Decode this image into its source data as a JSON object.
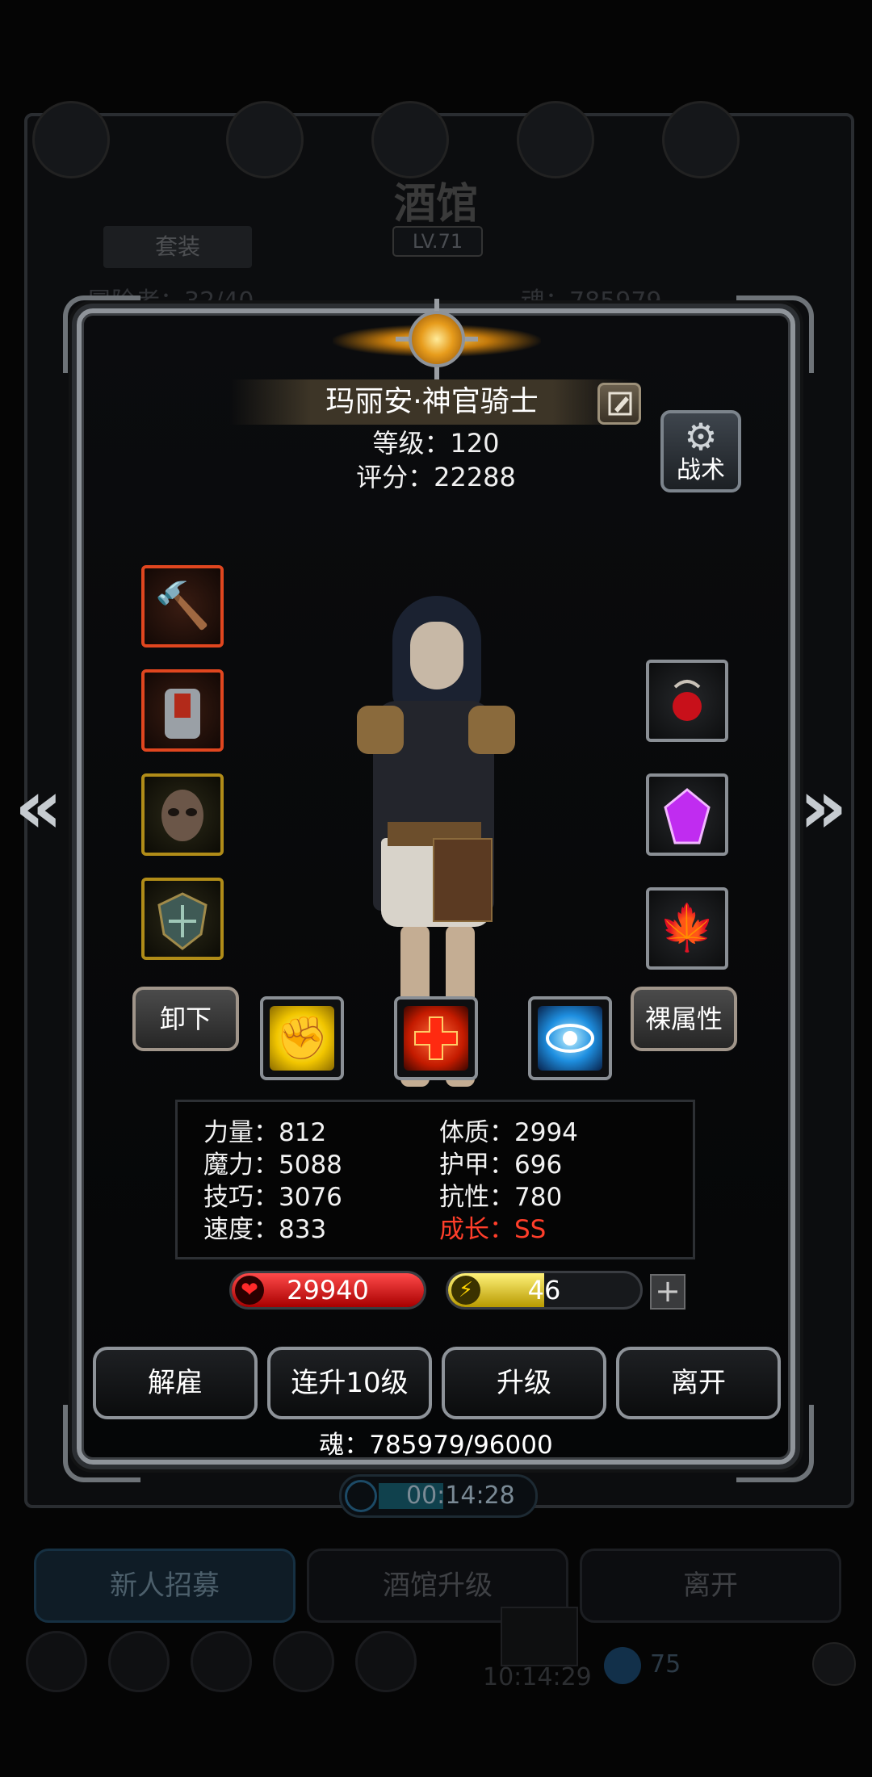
{
  "background": {
    "title": "酒馆",
    "level": "LV.71",
    "suit_tab": "套装",
    "count_text": "冒险者：32/40",
    "soul_text": "魂：785979",
    "timer": "00:14:28",
    "buttons": [
      "新人招募",
      "酒馆升级",
      "离开"
    ],
    "chest_timer": "10:14:29",
    "gem_count": "75"
  },
  "hero": {
    "name": "玛丽安·神官骑士",
    "level_text": "等级：120",
    "score_text": "评分：22288"
  },
  "tactics_label": "战术",
  "unequip_label": "卸下",
  "base_attr_label": "裸属性",
  "equipment": {
    "left": [
      "mace-icon",
      "armor-icon",
      "mask-icon",
      "shield-icon"
    ],
    "right": [
      "amulet-icon",
      "purple-gem-icon",
      "maple-leaf-icon"
    ]
  },
  "skills": [
    "fist-skill-icon",
    "heal-cross-skill-icon",
    "eye-skill-icon"
  ],
  "stats": {
    "strength": "力量：812",
    "magic": "魔力：5088",
    "skill": "技巧：3076",
    "speed": "速度：833",
    "constitution": "体质：2994",
    "armor": "护甲：696",
    "resistance": "抗性：780",
    "growth": "成长：SS"
  },
  "hp": {
    "value": "29940",
    "fill": 1.0
  },
  "energy": {
    "value": "46",
    "fill": 0.5
  },
  "actions": [
    "解雇",
    "连升10级",
    "升级",
    "离开"
  ],
  "soul_progress": "魂：785979/96000",
  "colors": {
    "growth": "#ff3e2a",
    "hp": "#d40000",
    "energy": "#e6cc00"
  }
}
